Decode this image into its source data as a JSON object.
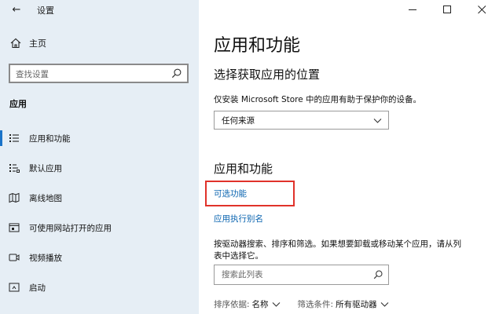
{
  "window": {
    "title": "设置",
    "back_glyph": "←",
    "controls": [
      "minimize",
      "maximize",
      "close"
    ]
  },
  "sidebar": {
    "home_label": "主页",
    "search_placeholder": "查找设置",
    "section_title": "应用",
    "items": [
      {
        "label": "应用和功能",
        "icon": "apps-list-icon",
        "selected": true
      },
      {
        "label": "默认应用",
        "icon": "default-apps-icon",
        "selected": false
      },
      {
        "label": "离线地图",
        "icon": "offline-maps-icon",
        "selected": false
      },
      {
        "label": "可使用网站打开的应用",
        "icon": "website-apps-icon",
        "selected": false
      },
      {
        "label": "视频播放",
        "icon": "video-playback-icon",
        "selected": false
      },
      {
        "label": "启动",
        "icon": "startup-icon",
        "selected": false
      }
    ]
  },
  "main": {
    "title": "应用和功能",
    "install_section": {
      "heading": "选择获取应用的位置",
      "description": "仅安装 Microsoft Store 中的应用有助于保护你的设备。",
      "dropdown_value": "任何来源"
    },
    "apps_section": {
      "heading": "应用和功能",
      "optional_features_link": "可选功能",
      "app_alias_link": "应用执行别名",
      "description_line1": "按驱动器搜索、排序和筛选。如果想要卸载或移动某个应用，请从列",
      "description_line2": "表中选择它。",
      "search_placeholder": "搜索此列表",
      "sort_label": "排序依据:",
      "sort_value": "名称",
      "filter_label": "筛选条件:",
      "filter_value": "所有驱动器"
    }
  },
  "colors": {
    "sidebar_bg": "#e6eef5",
    "accent": "#0a64b0",
    "highlight": "#e0322a"
  }
}
